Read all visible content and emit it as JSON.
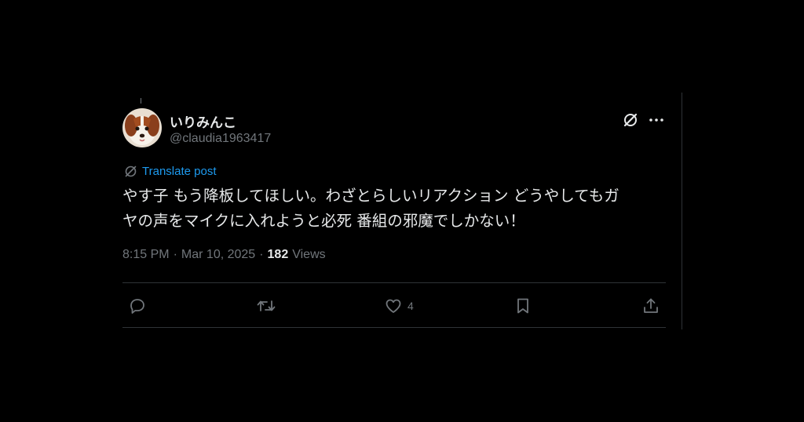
{
  "post": {
    "display_name": "いりみんこ",
    "handle": "@claudia1963417",
    "translate_label": "Translate post",
    "text_lines": [
      "やす子 もう降板してほしい。わざとらしいリアクション どうやしてもガ",
      "ヤの声をマイクに入れようと必死 番組の邪魔でしかない！"
    ],
    "time": "8:15 PM",
    "separator": "·",
    "date": "Mar 10, 2025",
    "views_count": "182",
    "views_label": "Views"
  },
  "actions": {
    "reply_count": "",
    "repost_count": "",
    "like_count": "4",
    "bookmark_count": "",
    "share_count": ""
  },
  "icons": {
    "grok": "grok-icon",
    "more": "more-horizontal-icon",
    "translate": "translate-globe-icon",
    "reply": "reply-icon",
    "repost": "repost-icon",
    "like": "heart-icon",
    "bookmark": "bookmark-icon",
    "share": "share-icon"
  },
  "colors": {
    "background": "#000000",
    "text_primary": "#e7e9ea",
    "text_secondary": "#71767b",
    "link": "#1d9bf0",
    "border": "#2f3336"
  }
}
